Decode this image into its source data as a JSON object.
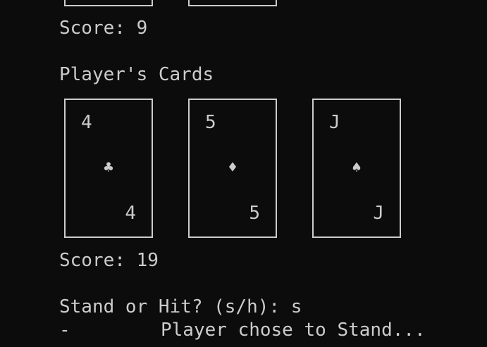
{
  "dealer": {
    "score_line": "Score: 9"
  },
  "player": {
    "heading": "Player's Cards",
    "cards": [
      {
        "rank": "4",
        "suit": "♣"
      },
      {
        "rank": "5",
        "suit": "♦"
      },
      {
        "rank": "J",
        "suit": "♠"
      }
    ],
    "score_line": "Score: 19"
  },
  "prompt": {
    "text": "Stand or Hit? (s/h): s"
  },
  "status": {
    "spinner": "-",
    "message": "Player chose to Stand..."
  }
}
